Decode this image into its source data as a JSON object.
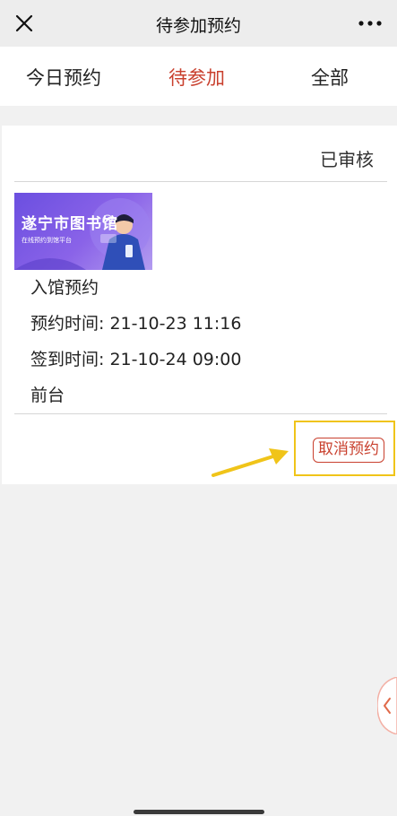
{
  "header": {
    "title": "待参加预约",
    "close_icon": "close-icon",
    "more_icon": "more-dots-icon"
  },
  "tabs": [
    {
      "label": "今日预约",
      "active": false
    },
    {
      "label": "待参加",
      "active": true
    },
    {
      "label": "全部",
      "active": false
    }
  ],
  "reservation": {
    "status": "已审核",
    "banner": {
      "title": "遂宁市图书馆",
      "subtitle": "在线预约到馆平台"
    },
    "type": "入馆预约",
    "reserve_time": "预约时间: 21-10-23 11:16",
    "checkin_time": "签到时间: 21-10-24 09:00",
    "location": "前台",
    "cancel_label": "取消预约"
  },
  "colors": {
    "accent": "#c9402e",
    "highlight": "#f0c419",
    "banner": "#7b5ae6"
  }
}
